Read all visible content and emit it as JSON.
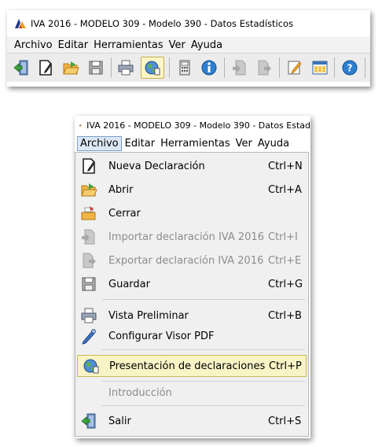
{
  "window_top": {
    "title": "IVA 2016 - MODELO 309 - Modelo 390 - Datos Estadísticos",
    "menu": [
      "Archivo",
      "Editar",
      "Herramientas",
      "Ver",
      "Ayuda"
    ],
    "toolbar_icons": [
      "exit-icon",
      "new-declaration-icon",
      "open-folder-icon",
      "save-icon",
      "print-icon",
      "presentation-globe-icon",
      "calculator-icon",
      "info-icon",
      "import-icon",
      "export-icon",
      "edit-icon",
      "window-icon",
      "help-icon"
    ]
  },
  "window_menu": {
    "title": "IVA 2016 - MODELO 309 - Modelo 390 - Datos Estad",
    "menu": [
      "Archivo",
      "Editar",
      "Herramientas",
      "Ver",
      "Ayuda"
    ],
    "open_menu": "Archivo",
    "items": [
      {
        "label": "Nueva Declaración",
        "shortcut": "Ctrl+N",
        "icon": "new-declaration-icon"
      },
      {
        "label": "Abrir",
        "shortcut": "Ctrl+A",
        "icon": "open-folder-icon"
      },
      {
        "label": "Cerrar",
        "shortcut": "",
        "icon": "close-folder-icon"
      },
      {
        "label": "Importar declaración IVA 2016",
        "shortcut": "Ctrl+I",
        "icon": "import-icon"
      },
      {
        "label": "Exportar declaración IVA 2016",
        "shortcut": "Ctrl+E",
        "icon": "export-icon"
      },
      {
        "label": "Guardar",
        "shortcut": "Ctrl+G",
        "icon": "save-icon"
      },
      {
        "label": "Vista Preliminar",
        "shortcut": "Ctrl+B",
        "icon": "print-icon"
      },
      {
        "label": "Configurar Visor PDF",
        "shortcut": "",
        "icon": "pdf-config-icon"
      },
      {
        "label": "Presentación de declaraciones",
        "shortcut": "Ctrl+P",
        "icon": "presentation-globe-icon"
      },
      {
        "label": "Introducción",
        "shortcut": "",
        "icon": ""
      },
      {
        "label": "Salir",
        "shortcut": "Ctrl+S",
        "icon": "exit-icon"
      }
    ]
  },
  "colors": {
    "highlight_bg": "#f8f4c6",
    "highlight_border": "#c9bb52",
    "menu_bg": "#f0f0f0",
    "disabled_text": "#8c8c8c"
  }
}
